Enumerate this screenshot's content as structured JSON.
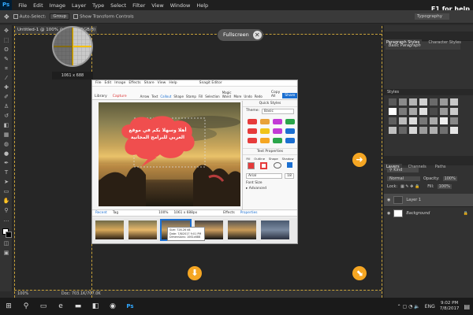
{
  "app": {
    "logo": "Ps",
    "help": "F1 for help"
  },
  "menu": [
    "File",
    "Edit",
    "Image",
    "Layer",
    "Type",
    "Select",
    "Filter",
    "View",
    "Window",
    "Help"
  ],
  "options": {
    "auto_select": "Auto-Select:",
    "group": "Group",
    "transform": "Show Transform Controls",
    "workspace": "Typography"
  },
  "doc": {
    "tab": "Untitled-1 @ 100% (Layer 1, RGB/8)",
    "zoom": "100%",
    "info": "Doc: 703.1K/707.0K"
  },
  "fullscreen": "Fullscreen",
  "magnifier": {
    "readout": "1061 x 688"
  },
  "snagit": {
    "title": "Snagit Editor",
    "menu": [
      "File",
      "Edit",
      "Image",
      "Effects",
      "Share",
      "View",
      "Help"
    ],
    "toolbar": [
      "Library",
      "Capture",
      "Arrow",
      "Text",
      "Callout",
      "Shape",
      "Stamp",
      "Fill",
      "Selection",
      "Magic Wand",
      "More",
      "Undo",
      "Redo",
      "Copy All",
      "Share"
    ],
    "callout_text": "أهلا وسهلا بكم في موقع العربي للبرامج المجانية",
    "side_title": "Quick Styles",
    "theme_label": "Theme:",
    "theme_value": "Basic",
    "text_props": "Text Properties",
    "font": "Arial",
    "font_size": "18",
    "prop_fill": "Fill",
    "prop_outline": "Outline",
    "prop_shape": "Shape",
    "prop_shadow": "Shadow",
    "font_label": "Font Size",
    "advanced": "Advanced",
    "bottom": {
      "recent": "Recent",
      "tag": "Tag",
      "zoom": "100%",
      "size": "1061 x 688px",
      "effects": "Effects",
      "properties": "Properties"
    },
    "tray_tip": [
      "Size: 726.26 kB",
      "Date: 7/8/2017 9:01 PM",
      "Dimensions: 1061x688"
    ]
  },
  "panels": {
    "tabs1": [
      "Paragraph Styles",
      "Character Styles"
    ],
    "basic": "Basic Paragraph",
    "styles": "Styles",
    "tabs2": [
      "Layers",
      "Channels",
      "Paths"
    ],
    "kind": "Kind",
    "blend": "Normal",
    "opacity_label": "Opacity:",
    "opacity": "100%",
    "lock": "Lock:",
    "fill_label": "Fill:",
    "fill": "100%",
    "layers": [
      "Layer 1",
      "Background"
    ]
  },
  "taskbar": {
    "lang": "ENG",
    "time": "9:02 PM",
    "date": "7/8/2017"
  },
  "colors": {
    "accent": "#f5a623",
    "ps_blue": "#31a8ff",
    "guide": "#c8a23a",
    "callout": "#f04e4e"
  }
}
